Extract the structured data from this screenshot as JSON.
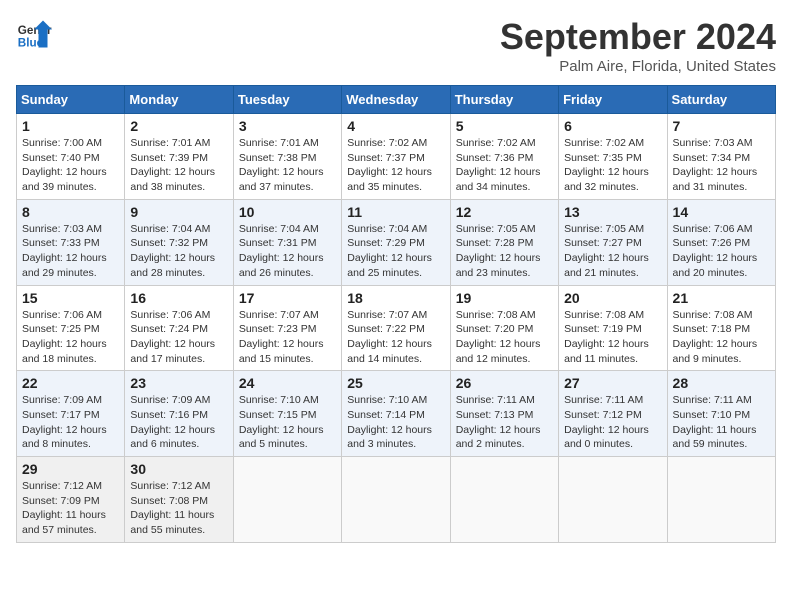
{
  "header": {
    "logo_line1": "General",
    "logo_line2": "Blue",
    "title": "September 2024",
    "location": "Palm Aire, Florida, United States"
  },
  "weekdays": [
    "Sunday",
    "Monday",
    "Tuesday",
    "Wednesday",
    "Thursday",
    "Friday",
    "Saturday"
  ],
  "weeks": [
    [
      {
        "day": "1",
        "sunrise": "7:00 AM",
        "sunset": "7:40 PM",
        "daylight": "12 hours and 39 minutes."
      },
      {
        "day": "2",
        "sunrise": "7:01 AM",
        "sunset": "7:39 PM",
        "daylight": "12 hours and 38 minutes."
      },
      {
        "day": "3",
        "sunrise": "7:01 AM",
        "sunset": "7:38 PM",
        "daylight": "12 hours and 37 minutes."
      },
      {
        "day": "4",
        "sunrise": "7:02 AM",
        "sunset": "7:37 PM",
        "daylight": "12 hours and 35 minutes."
      },
      {
        "day": "5",
        "sunrise": "7:02 AM",
        "sunset": "7:36 PM",
        "daylight": "12 hours and 34 minutes."
      },
      {
        "day": "6",
        "sunrise": "7:02 AM",
        "sunset": "7:35 PM",
        "daylight": "12 hours and 32 minutes."
      },
      {
        "day": "7",
        "sunrise": "7:03 AM",
        "sunset": "7:34 PM",
        "daylight": "12 hours and 31 minutes."
      }
    ],
    [
      {
        "day": "8",
        "sunrise": "7:03 AM",
        "sunset": "7:33 PM",
        "daylight": "12 hours and 29 minutes."
      },
      {
        "day": "9",
        "sunrise": "7:04 AM",
        "sunset": "7:32 PM",
        "daylight": "12 hours and 28 minutes."
      },
      {
        "day": "10",
        "sunrise": "7:04 AM",
        "sunset": "7:31 PM",
        "daylight": "12 hours and 26 minutes."
      },
      {
        "day": "11",
        "sunrise": "7:04 AM",
        "sunset": "7:29 PM",
        "daylight": "12 hours and 25 minutes."
      },
      {
        "day": "12",
        "sunrise": "7:05 AM",
        "sunset": "7:28 PM",
        "daylight": "12 hours and 23 minutes."
      },
      {
        "day": "13",
        "sunrise": "7:05 AM",
        "sunset": "7:27 PM",
        "daylight": "12 hours and 21 minutes."
      },
      {
        "day": "14",
        "sunrise": "7:06 AM",
        "sunset": "7:26 PM",
        "daylight": "12 hours and 20 minutes."
      }
    ],
    [
      {
        "day": "15",
        "sunrise": "7:06 AM",
        "sunset": "7:25 PM",
        "daylight": "12 hours and 18 minutes."
      },
      {
        "day": "16",
        "sunrise": "7:06 AM",
        "sunset": "7:24 PM",
        "daylight": "12 hours and 17 minutes."
      },
      {
        "day": "17",
        "sunrise": "7:07 AM",
        "sunset": "7:23 PM",
        "daylight": "12 hours and 15 minutes."
      },
      {
        "day": "18",
        "sunrise": "7:07 AM",
        "sunset": "7:22 PM",
        "daylight": "12 hours and 14 minutes."
      },
      {
        "day": "19",
        "sunrise": "7:08 AM",
        "sunset": "7:20 PM",
        "daylight": "12 hours and 12 minutes."
      },
      {
        "day": "20",
        "sunrise": "7:08 AM",
        "sunset": "7:19 PM",
        "daylight": "12 hours and 11 minutes."
      },
      {
        "day": "21",
        "sunrise": "7:08 AM",
        "sunset": "7:18 PM",
        "daylight": "12 hours and 9 minutes."
      }
    ],
    [
      {
        "day": "22",
        "sunrise": "7:09 AM",
        "sunset": "7:17 PM",
        "daylight": "12 hours and 8 minutes."
      },
      {
        "day": "23",
        "sunrise": "7:09 AM",
        "sunset": "7:16 PM",
        "daylight": "12 hours and 6 minutes."
      },
      {
        "day": "24",
        "sunrise": "7:10 AM",
        "sunset": "7:15 PM",
        "daylight": "12 hours and 5 minutes."
      },
      {
        "day": "25",
        "sunrise": "7:10 AM",
        "sunset": "7:14 PM",
        "daylight": "12 hours and 3 minutes."
      },
      {
        "day": "26",
        "sunrise": "7:11 AM",
        "sunset": "7:13 PM",
        "daylight": "12 hours and 2 minutes."
      },
      {
        "day": "27",
        "sunrise": "7:11 AM",
        "sunset": "7:12 PM",
        "daylight": "12 hours and 0 minutes."
      },
      {
        "day": "28",
        "sunrise": "7:11 AM",
        "sunset": "7:10 PM",
        "daylight": "11 hours and 59 minutes."
      }
    ],
    [
      {
        "day": "29",
        "sunrise": "7:12 AM",
        "sunset": "7:09 PM",
        "daylight": "11 hours and 57 minutes."
      },
      {
        "day": "30",
        "sunrise": "7:12 AM",
        "sunset": "7:08 PM",
        "daylight": "11 hours and 55 minutes."
      },
      null,
      null,
      null,
      null,
      null
    ]
  ]
}
